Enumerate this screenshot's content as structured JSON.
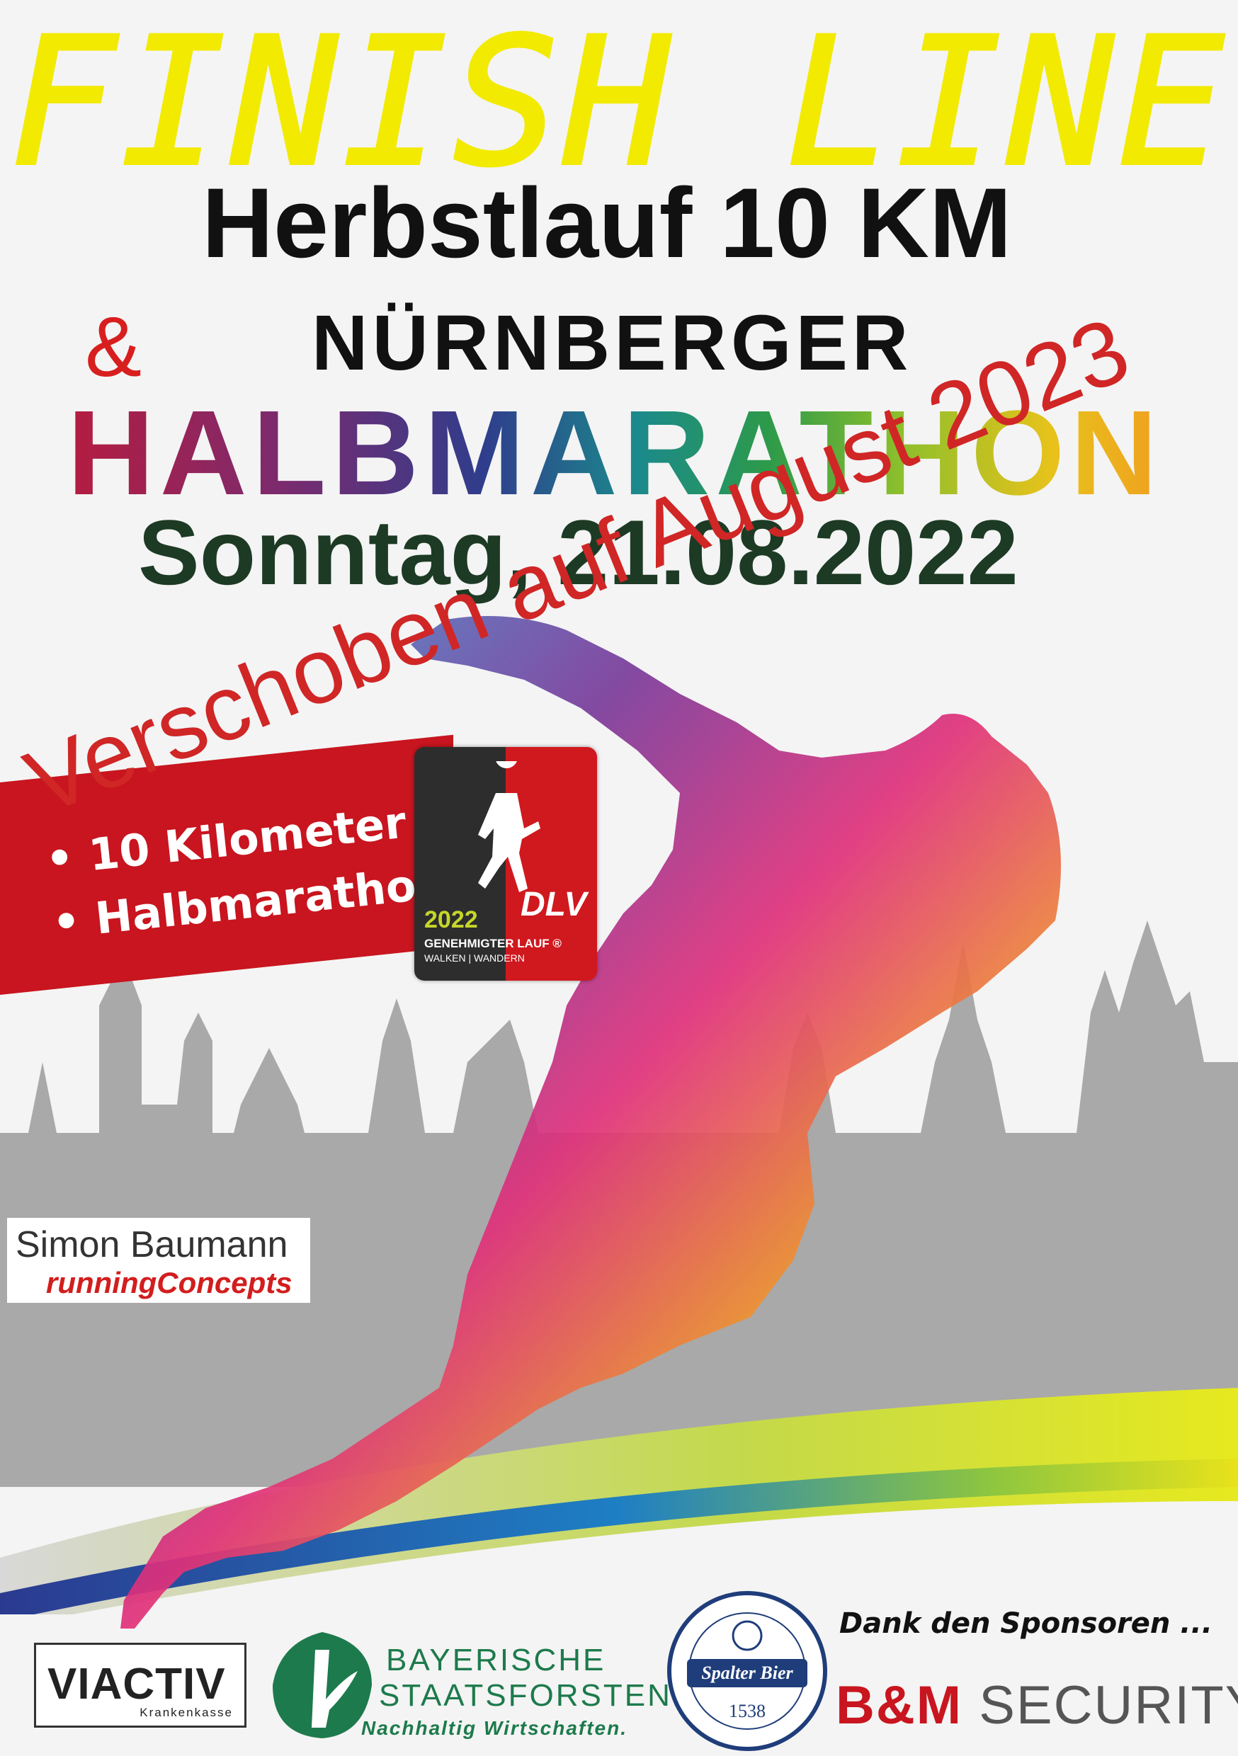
{
  "poster": {
    "title": "FINISH LINE",
    "subtitle": "Herbstlauf 10 KM",
    "ampersand": "&",
    "event_line1": "NÜRNBERGER",
    "event_line2": "HALBMARATHON",
    "date": "Sonntag, 21.08.2022",
    "postponed": "Verschoben auf August 2023"
  },
  "distances": [
    "• 10 Kilometer",
    "• Halbmarathon"
  ],
  "dlv_badge": {
    "year": "2022",
    "label": "GENEHMIGTER LAUF ®",
    "sub": "WALKEN | WANDERN",
    "logo": "DLV"
  },
  "organizer": {
    "name": "Simon Baumann",
    "company": "runningConcepts"
  },
  "sponsors": {
    "thanks": "Dank den Sponsoren ...",
    "viactiv": "VIACTIV",
    "viactiv_sub": "Krankenkasse",
    "bsf_line1": "BAYERISCHE",
    "bsf_line2": "STAATSFORSTEN",
    "bsf_slogan": "Nachhaltig Wirtschaften.",
    "spalter": "Spalter Bier",
    "spalter_year": "1538",
    "bm_brand": "B&M",
    "bm_word": "SECURITY"
  },
  "colors": {
    "title_yellow": "#f2ea00",
    "banner_red": "#c8151f",
    "date_green": "#1d3a24",
    "postponed_red": "#d02626",
    "skyline_gray": "#a9a9a9"
  }
}
